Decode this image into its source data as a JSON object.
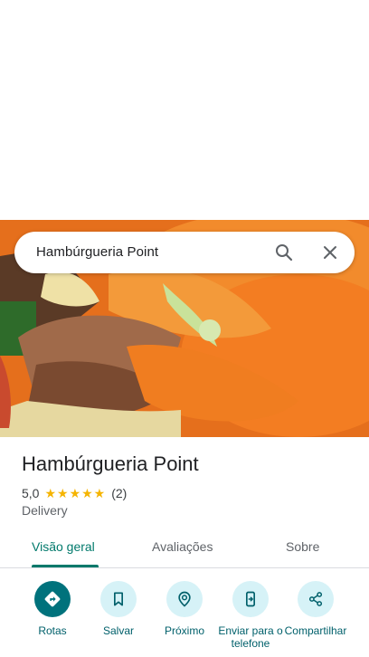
{
  "search": {
    "query": "Hambúrgueria Point"
  },
  "place": {
    "name": "Hambúrgueria Point",
    "rating": "5,0",
    "stars": "★★★★★",
    "review_count": "(2)",
    "category": "Delivery"
  },
  "tabs": [
    {
      "label": "Visão geral"
    },
    {
      "label": "Avaliações"
    },
    {
      "label": "Sobre"
    }
  ],
  "actions": [
    {
      "label": "Rotas",
      "icon": "directions-icon"
    },
    {
      "label": "Salvar",
      "icon": "bookmark-icon"
    },
    {
      "label": "Próximo",
      "icon": "nearby-icon"
    },
    {
      "label": "Enviar para o telefone",
      "icon": "send-to-phone-icon"
    },
    {
      "label": "Compartilhar",
      "icon": "share-icon"
    }
  ],
  "colors": {
    "accent": "#00796b",
    "action_bg": "#d6f2f7",
    "action_primary": "#00727c",
    "star": "#f5b400"
  }
}
